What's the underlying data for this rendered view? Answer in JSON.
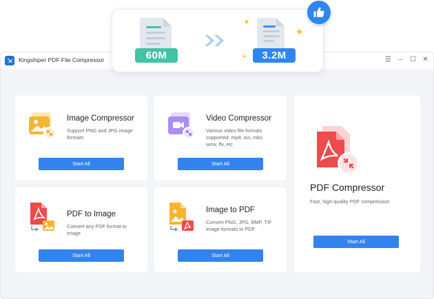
{
  "banner": {
    "before_size": "60M",
    "after_size": "3.2M"
  },
  "window": {
    "title": "Kingshiper PDF File Compressor",
    "controls": [
      "menu-icon",
      "minimize-icon",
      "maximize-icon",
      "close-icon"
    ]
  },
  "cards": {
    "image_compressor": {
      "title": "Image Compressor",
      "desc": [
        "Support PNG and JPG image",
        "formats"
      ],
      "button": "Start All"
    },
    "video_compressor": {
      "title": "Video Compressor",
      "desc": [
        "Various video file formats",
        "supported: mp4, avi, mkv,",
        "wmv, flv, etc"
      ],
      "button": "Start All"
    },
    "pdf_to_image": {
      "title": "PDF to Image",
      "desc": [
        "Convert any PDF format to",
        "image"
      ],
      "button": "Start All"
    },
    "image_to_pdf": {
      "title": "Image to PDF",
      "desc": [
        "Convert PNG, JPG, BMP, TIF",
        "image formats to PDF"
      ],
      "button": "Start All"
    },
    "pdf_compressor": {
      "title": "PDF Compressor",
      "desc": "Fast, high-quality PDF compression",
      "button": "Start All"
    }
  },
  "colors": {
    "accent": "#3283ef",
    "green": "#41c3a4",
    "pdf_red": "#ee4b4b",
    "image_orange": "#f6b433",
    "video_purple": "#a98df5"
  }
}
